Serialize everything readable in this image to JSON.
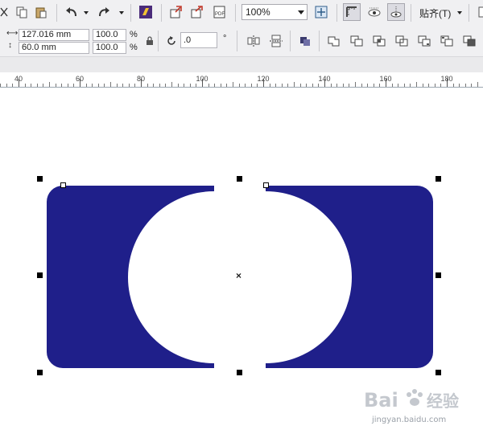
{
  "toolbar": {
    "zoom_value": "100%",
    "snap_label": "贴齐(T)",
    "icons": [
      "cut-icon",
      "copy-icon",
      "paste-icon",
      "undo-icon",
      "redo-icon",
      "corel-launcher-icon",
      "import-icon",
      "export-icon",
      "publish-pdf-icon",
      "full-screen-preview-icon",
      "show-rulers-icon",
      "show-grid-icon",
      "show-guidelines-icon"
    ]
  },
  "property_bar": {
    "width_value": "127.016 mm",
    "height_value": "60.0 mm",
    "scale_x": "100.0",
    "scale_y": "100.0",
    "percent_symbol": "%",
    "rotation_value": ".0",
    "degree_symbol": "°"
  },
  "ruler": {
    "labels": [
      "40",
      "60",
      "80",
      "100",
      "120",
      "140",
      "160",
      "180"
    ]
  },
  "canvas": {
    "shape_fill_color": "#1f1f8a",
    "selection_center_marker": "×"
  },
  "watermark": {
    "text": "Bai经验",
    "domain": "jingyan.baidu.com"
  }
}
